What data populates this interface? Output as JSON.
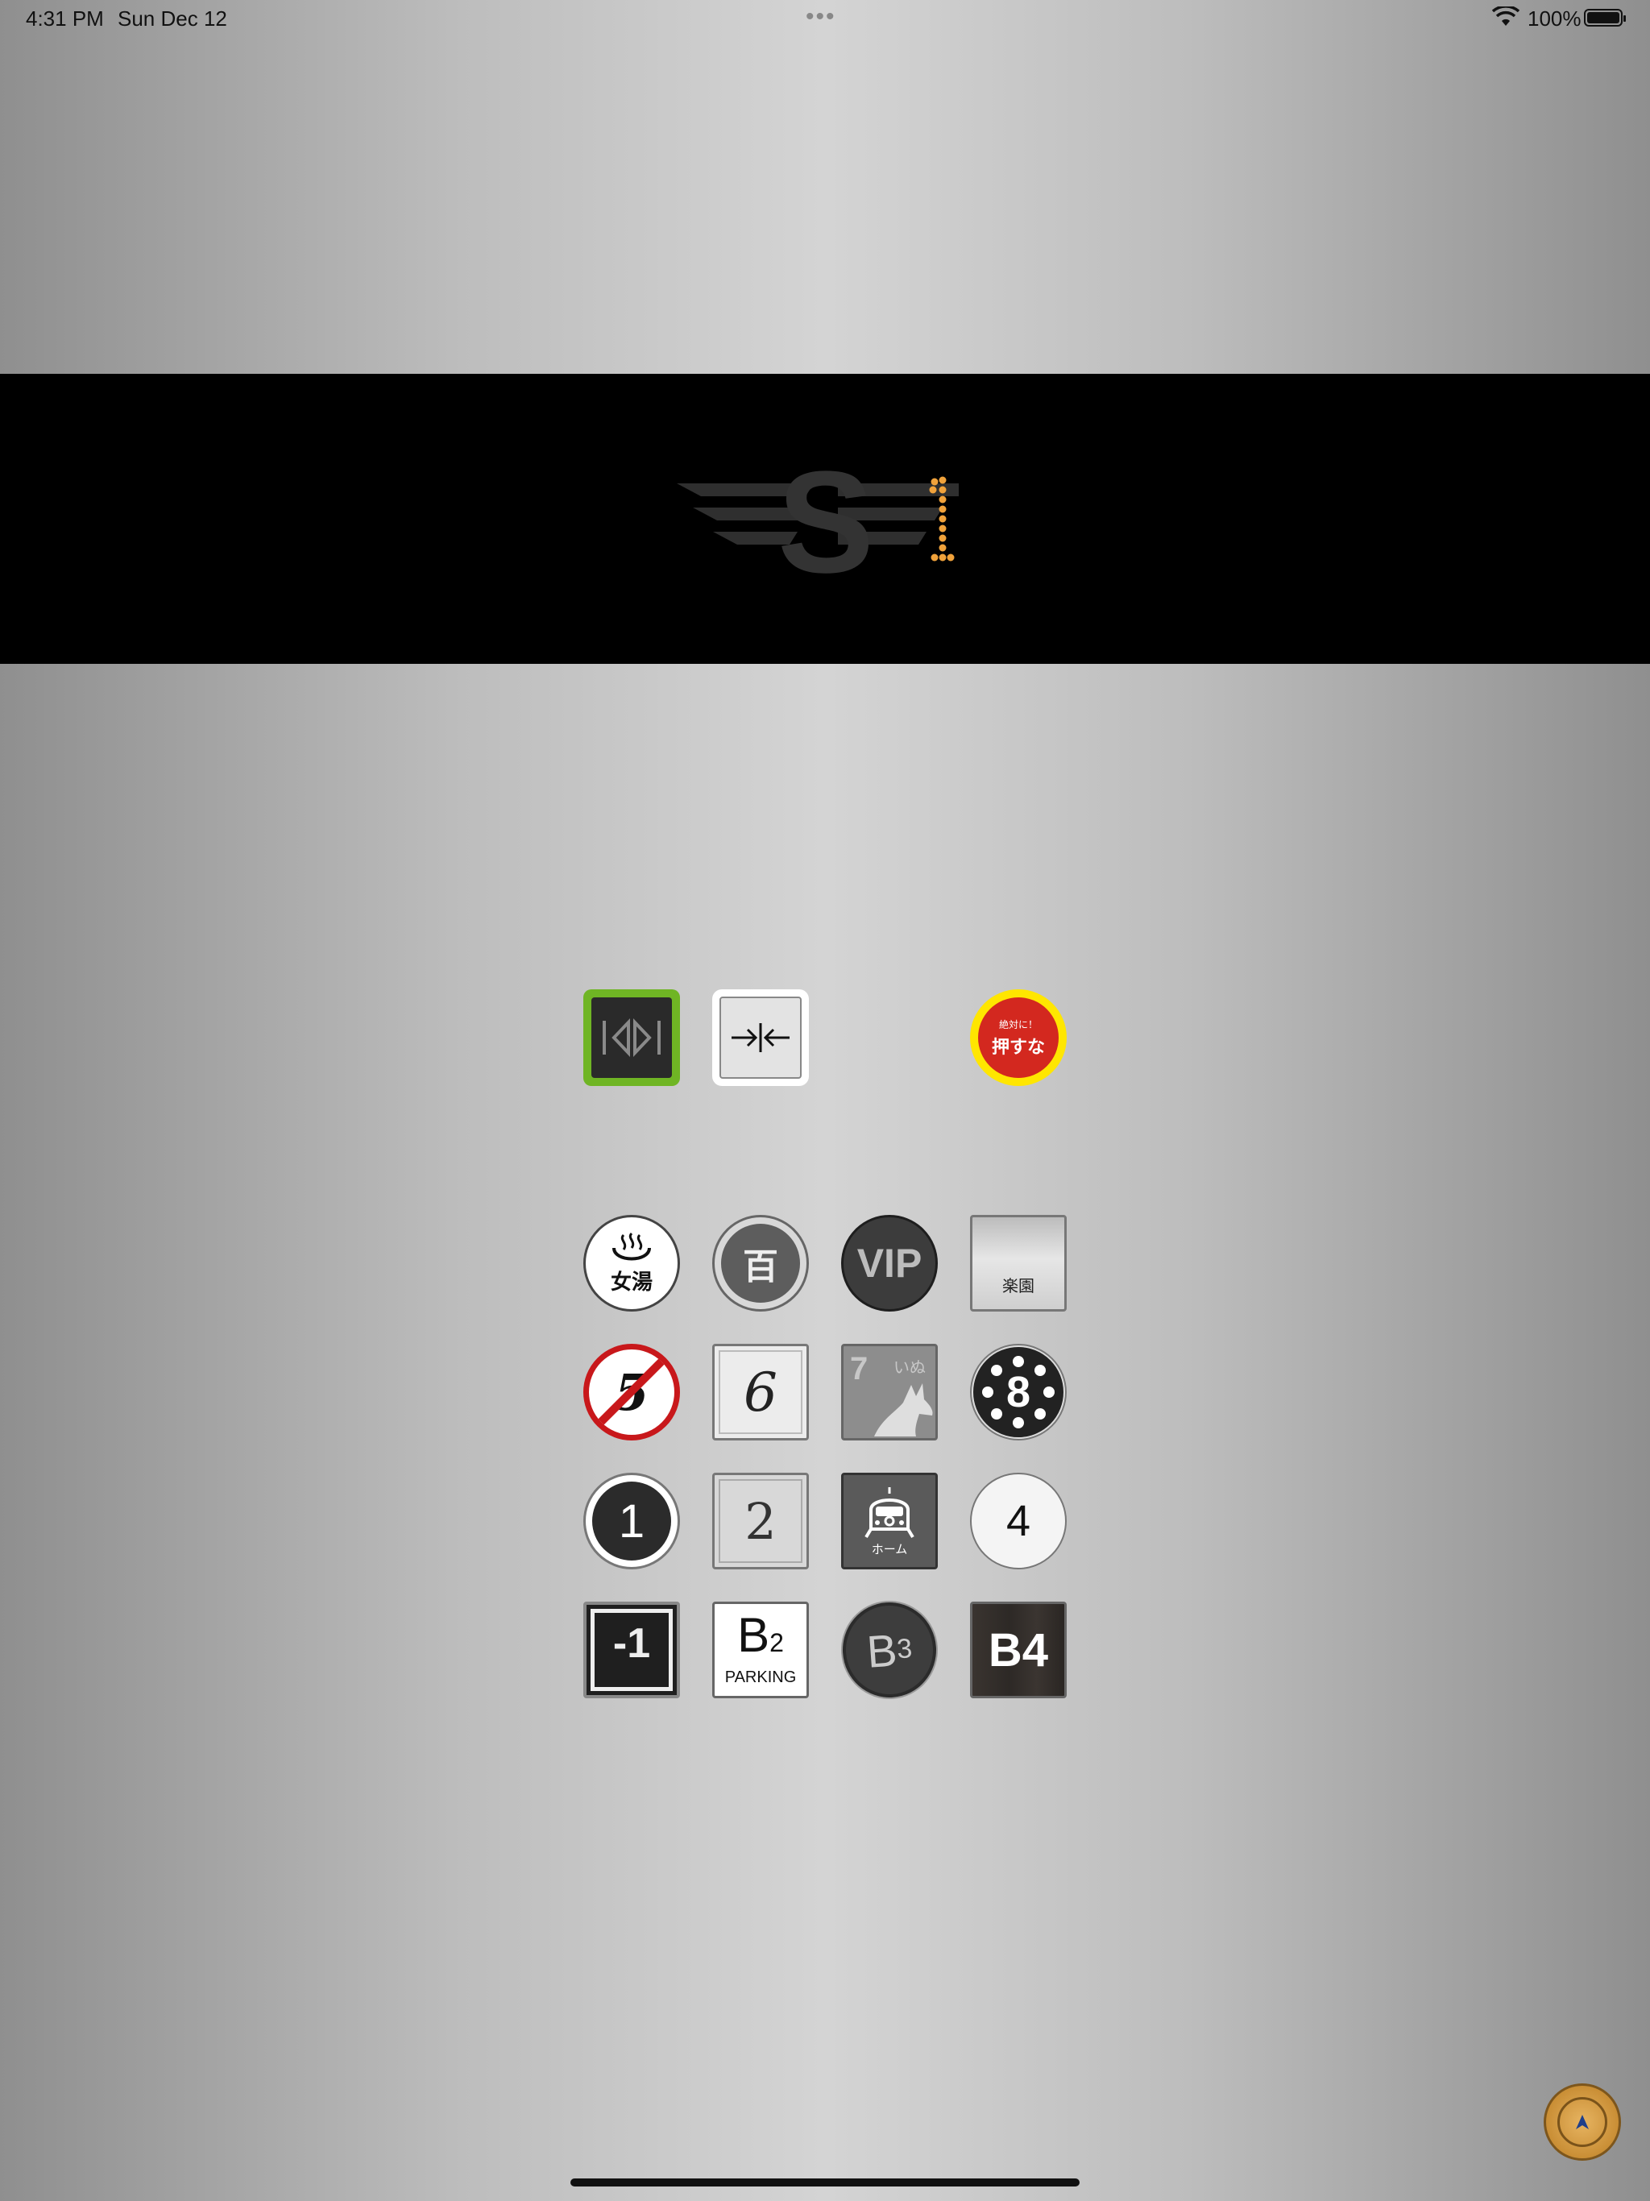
{
  "status_bar": {
    "time": "4:31 PM",
    "date": "Sun Dec 12",
    "battery_percent": "100%"
  },
  "display": {
    "logo_letter": "S",
    "floor_indicator": "1",
    "indicator_color": "#f0a23b"
  },
  "controls": {
    "open_door_icon": "door-open-icon",
    "close_door_icon": "door-close-icon",
    "warning_small": "絶対に！",
    "warning_big": "押すな"
  },
  "floor_buttons": {
    "row1": {
      "onsen_icon": "hot-spring-icon",
      "onsen_label": "女湯",
      "hyaku": "百",
      "vip": "VIP",
      "rakuen": "楽園"
    },
    "row2": {
      "five": "5",
      "six": "6",
      "seven": "7",
      "seven_kana": "いぬ",
      "eight": "8"
    },
    "row3": {
      "one": "1",
      "two": "2",
      "home_label": "ホーム",
      "four": "4"
    },
    "row4": {
      "minus_one": "-1",
      "b2_letter": "B",
      "b2_num": "2",
      "b2_caption": "PARKING",
      "b3_letter": "B",
      "b3_num": "3",
      "b4": "B4"
    }
  },
  "colors": {
    "open_border": "#6fb524",
    "warning_ring": "#ffe600",
    "warning_fill": "#d3281f",
    "no_entry_red": "#c8181b"
  }
}
